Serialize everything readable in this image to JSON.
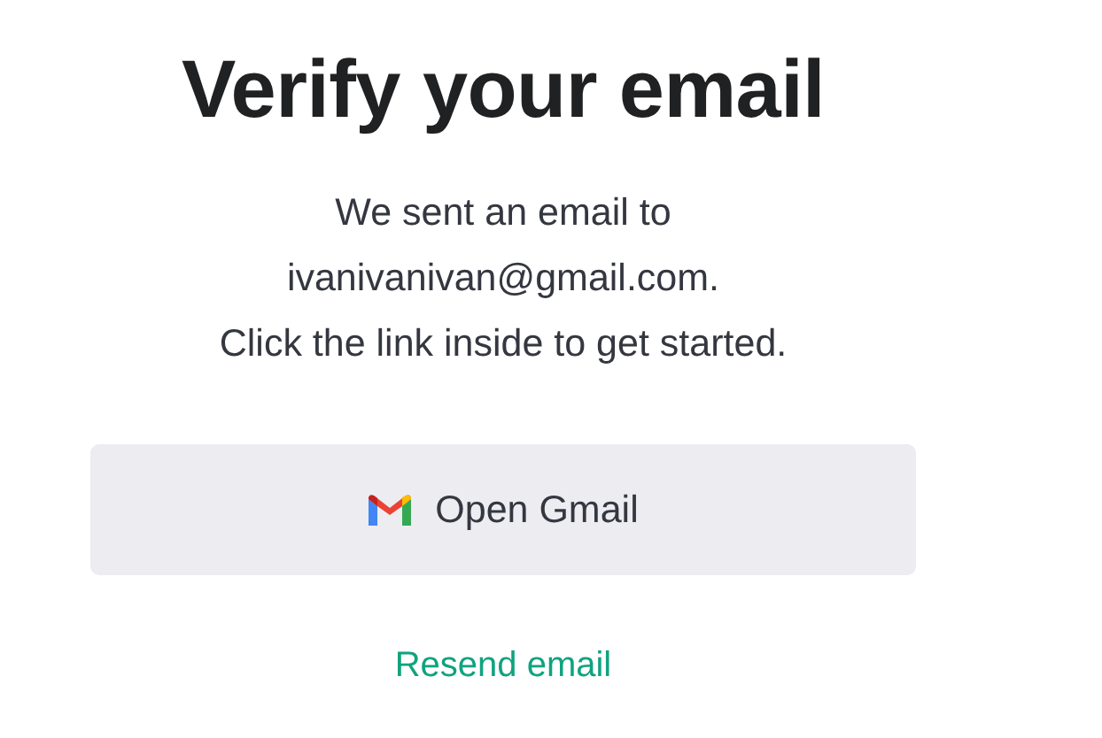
{
  "title": "Verify your email",
  "message_lines": [
    "We sent an email to",
    "ivanivanivan@gmail.com.",
    "Click the link inside to get started."
  ],
  "primary_button": {
    "label": "Open Gmail"
  },
  "resend_link": {
    "label": "Resend email"
  }
}
